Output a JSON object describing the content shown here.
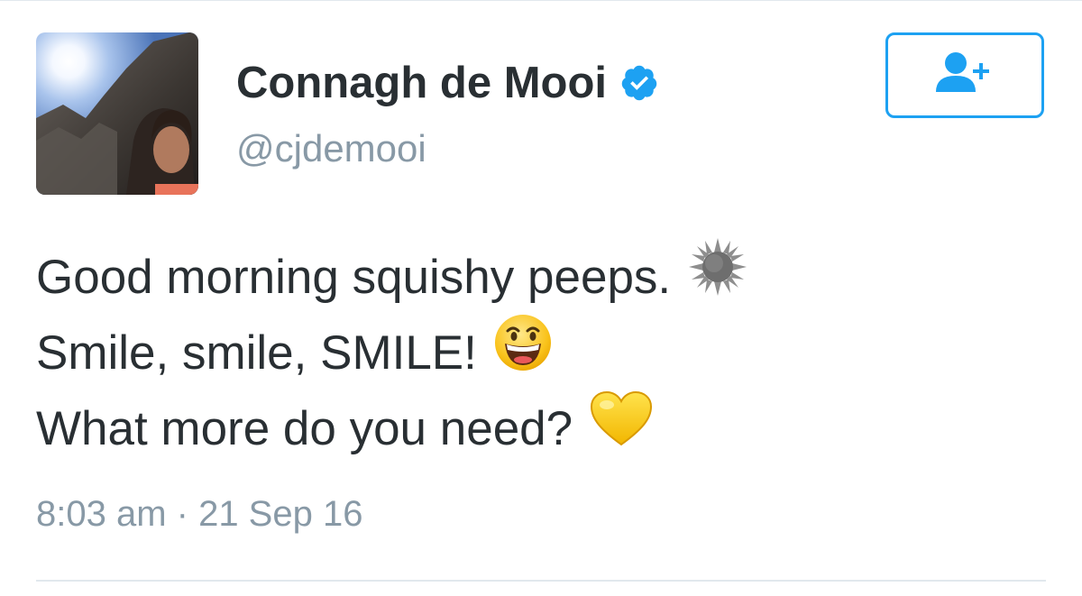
{
  "tweet": {
    "author": {
      "display_name": "Connagh de Mooi",
      "handle": "@cjdemooi",
      "verified": true,
      "verified_icon": "verified-badge-icon",
      "avatar_icon": "profile-photo"
    },
    "follow_button": {
      "icon": "follow-person-plus-icon"
    },
    "text_lines": [
      {
        "text": "Good morning squishy peeps.",
        "emoji": "sun-icon"
      },
      {
        "text": "Smile, smile, SMILE!",
        "emoji": "grinning-face-icon"
      },
      {
        "text": "What more do you need?",
        "emoji": "yellow-heart-icon"
      }
    ],
    "timestamp": "8:03 am · 21 Sep 16"
  },
  "colors": {
    "accent": "#1da1f2",
    "text_primary": "#292f33",
    "text_secondary": "#8899a6",
    "divider": "#e1e8ed"
  }
}
